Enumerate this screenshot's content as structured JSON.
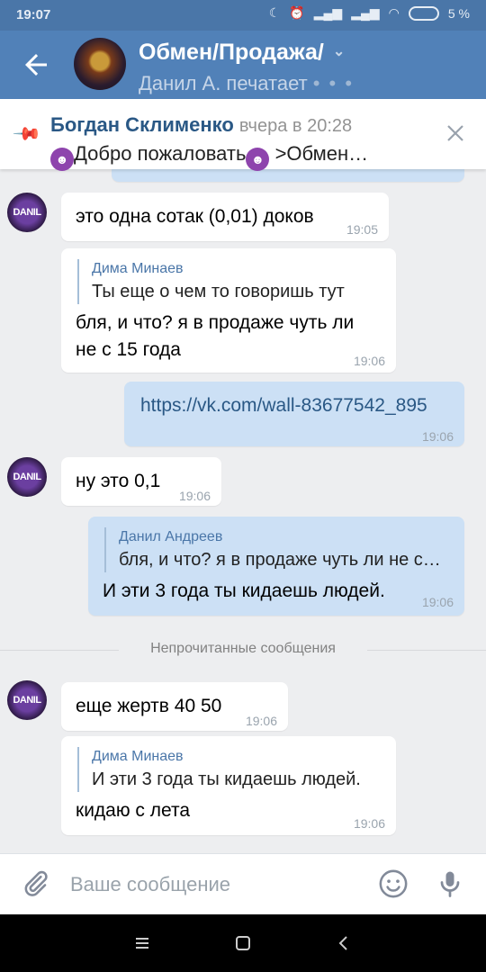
{
  "status": {
    "time": "19:07",
    "battery": "5 %"
  },
  "header": {
    "title": "Обмен/Продажа/",
    "subtitle": "Данил А. печатает",
    "typing_dots": "• • •"
  },
  "pinned": {
    "author": "Богдан Склименко",
    "time": "вчера в 20:28",
    "text_prefix": "Добро пожаловать",
    "text_suffix": " >Обмен…"
  },
  "messages": [
    {
      "text": "это одна сотак (0,01) доков",
      "time": "19:05"
    },
    {
      "quote_author": "Дима Минаев",
      "quote_text": "Ты еще о чем то говоришь тут",
      "line1": "бля, и что? я в продаже чуть ли",
      "line2": "не с 15 года",
      "time": "19:06"
    },
    {
      "text": "https://vk.com/wall-83677542_895",
      "time": "19:06"
    },
    {
      "text": "ну это 0,1",
      "time": "19:06"
    },
    {
      "quote_author": "Данил Андреев",
      "quote_text": "бля, и что? я в продаже чуть ли не с…",
      "text": "И эти 3 года ты кидаешь людей.",
      "time": "19:06"
    },
    {
      "text": "еще жертв 40 50",
      "time": "19:06"
    },
    {
      "quote_author": "Дима Минаев",
      "quote_text": "И эти 3 года ты кидаешь людей.",
      "text": "кидаю с лета",
      "time": "19:06"
    }
  ],
  "avatar_label": "DANIL",
  "divider": {
    "label": "Непрочитанные сообщения"
  },
  "composer": {
    "placeholder": "Ваше сообщение"
  },
  "colors": {
    "header": "#5181b8",
    "statusbar": "#4a76a8",
    "bg": "#edeef0",
    "outgoing": "#cce0f5",
    "link": "#2a5885"
  }
}
